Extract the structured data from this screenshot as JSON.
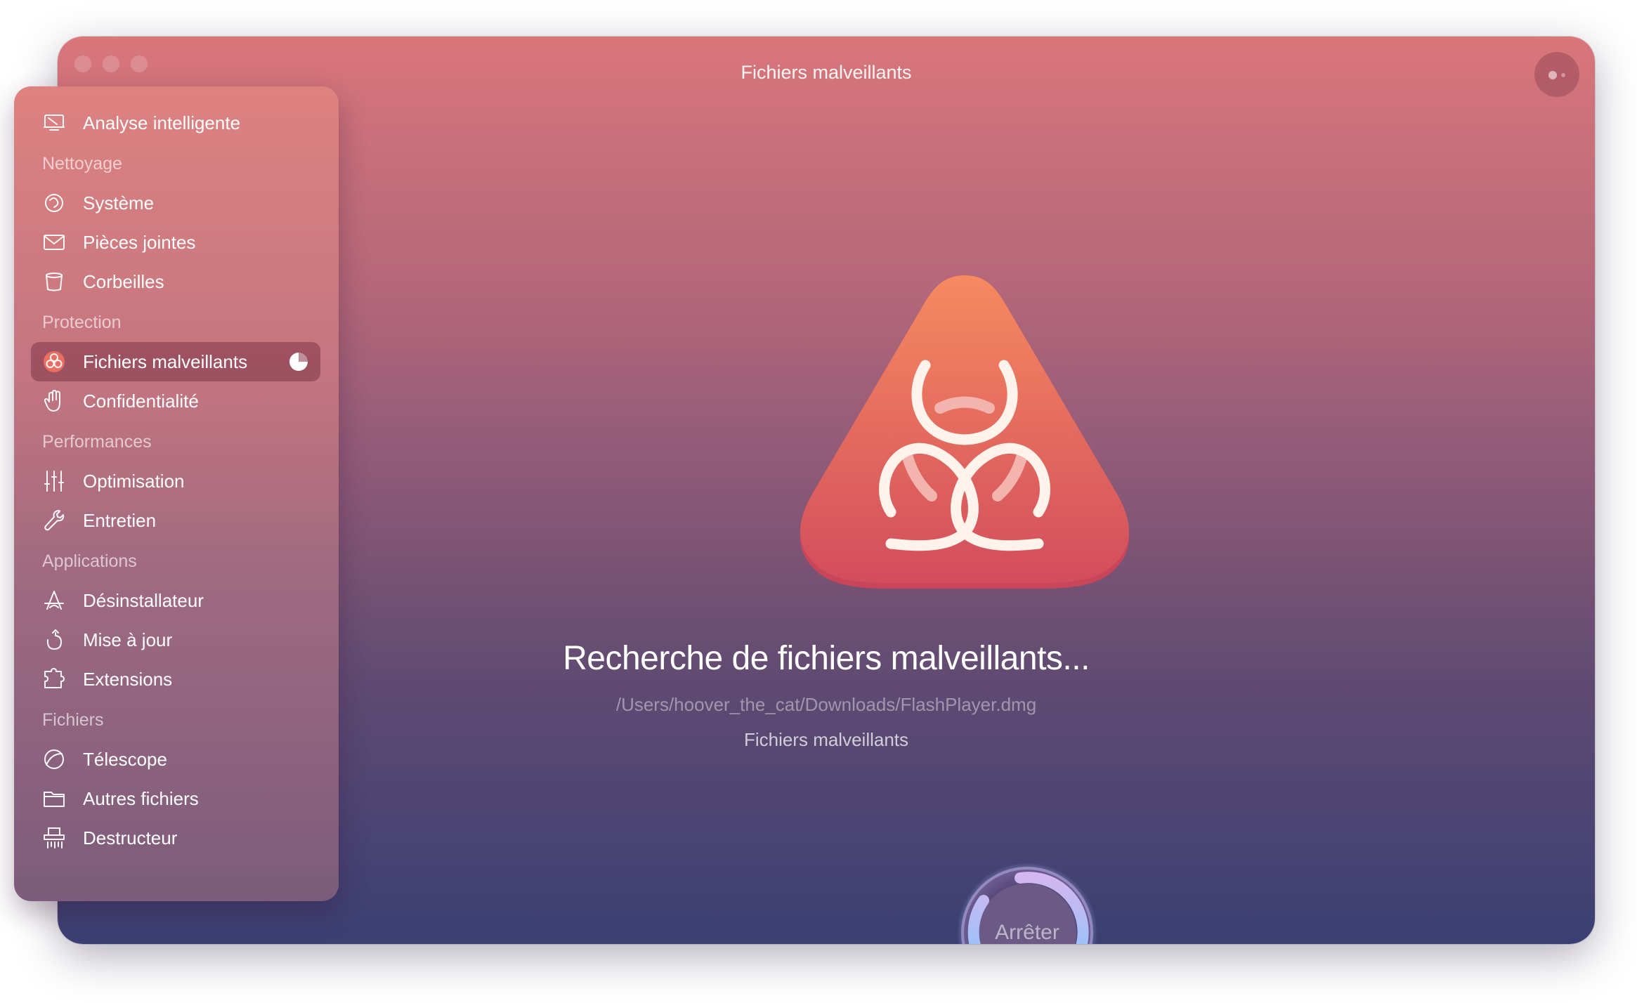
{
  "window": {
    "title": "Fichiers malveillants"
  },
  "sidebar": {
    "smart_scan": "Analyse intelligente",
    "sections": {
      "cleanup": "Nettoyage",
      "protection": "Protection",
      "performance": "Performances",
      "applications": "Applications",
      "files": "Fichiers"
    },
    "items": {
      "system": "Système",
      "mail_attachments": "Pièces jointes",
      "trash_bins": "Corbeilles",
      "malware": "Fichiers malveillants",
      "privacy": "Confidentialité",
      "optimization": "Optimisation",
      "maintenance": "Entretien",
      "uninstaller": "Désinstallateur",
      "updater": "Mise à jour",
      "extensions": "Extensions",
      "space_lens": "Télescope",
      "large_old_files": "Autres fichiers",
      "shredder": "Destructeur"
    },
    "active_item": "malware",
    "active_progress": 0.25
  },
  "main": {
    "scan_title": "Recherche de fichiers malveillants...",
    "scan_path": "/Users/hoover_the_cat/Downloads/FlashPlayer.dmg",
    "scan_category": "Fichiers malveillants",
    "stop_button": "Arrêter"
  },
  "colors": {
    "hazard_top": "#f4845f",
    "hazard_bottom": "#cf4a5c",
    "accent_ring_top": "#cbb0f2",
    "accent_ring_bottom": "#7cc6ff"
  }
}
